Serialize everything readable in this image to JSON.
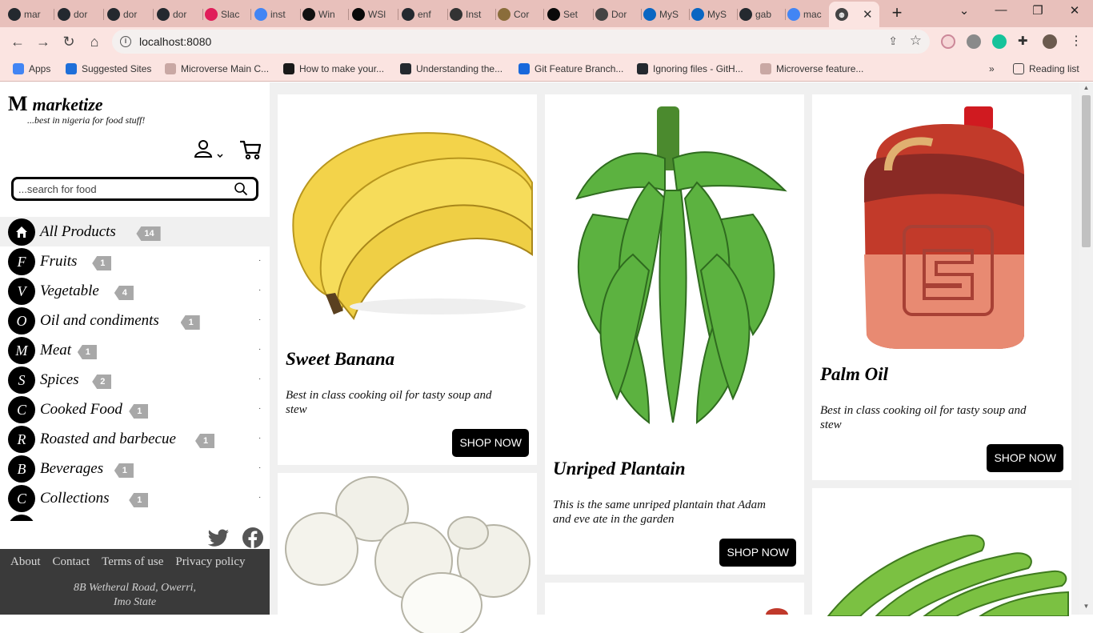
{
  "browser": {
    "tabs": [
      {
        "label": "mar",
        "color": "#24292f"
      },
      {
        "label": "dor",
        "color": "#24292f"
      },
      {
        "label": "dor",
        "color": "#24292f"
      },
      {
        "label": "dor",
        "color": "#24292f"
      },
      {
        "label": "Slac",
        "color": "#e01e5a"
      },
      {
        "label": "inst",
        "color": "#4285f4"
      },
      {
        "label": "Win",
        "color": "#111111"
      },
      {
        "label": "WSl",
        "color": "#0a0a0a"
      },
      {
        "label": "enf",
        "color": "#24292f"
      },
      {
        "label": "Inst",
        "color": "#333333"
      },
      {
        "label": "Cor",
        "color": "#8a6d3b"
      },
      {
        "label": "Set",
        "color": "#0a0a0a"
      },
      {
        "label": "Dor",
        "color": "#444444"
      },
      {
        "label": "MyS",
        "color": "#0a66c2"
      },
      {
        "label": "MyS",
        "color": "#0a66c2"
      },
      {
        "label": "gab",
        "color": "#24292f"
      },
      {
        "label": "mac",
        "color": "#4285f4"
      }
    ],
    "url": "localhost:8080",
    "bookmarks": [
      {
        "label": "Apps",
        "color": "#4285f4"
      },
      {
        "label": "Suggested Sites",
        "color": "#1e6fd9"
      },
      {
        "label": "Microverse Main C...",
        "color": "#c9a8a4"
      },
      {
        "label": "How to make your...",
        "color": "#1a1a1a"
      },
      {
        "label": "Understanding the...",
        "color": "#24292f"
      },
      {
        "label": "Git Feature Branch...",
        "color": "#1868db"
      },
      {
        "label": "Ignoring files - GitH...",
        "color": "#24292f"
      },
      {
        "label": "Microverse feature...",
        "color": "#c9a8a4"
      }
    ],
    "reading_list": "Reading list",
    "more_bookmarks": "»"
  },
  "brand": {
    "logo_letter": "M",
    "name": "marketize",
    "tagline": "...best in nigeria for food stuff!"
  },
  "search": {
    "placeholder": "...search for food"
  },
  "categories": [
    {
      "letter": "",
      "icon": "home-icon",
      "name": "All Products",
      "count": "14",
      "active": true
    },
    {
      "letter": "F",
      "name": "Fruits",
      "count": "1"
    },
    {
      "letter": "V",
      "name": "Vegetable",
      "count": "4"
    },
    {
      "letter": "O",
      "name": "Oil and condiments",
      "count": "1"
    },
    {
      "letter": "M",
      "name": "Meat",
      "count": "1"
    },
    {
      "letter": "S",
      "name": "Spices",
      "count": "2"
    },
    {
      "letter": "C",
      "name": "Cooked Food",
      "count": "1"
    },
    {
      "letter": "R",
      "name": "Roasted and barbecue",
      "count": "1"
    },
    {
      "letter": "B",
      "name": "Beverages",
      "count": "1"
    },
    {
      "letter": "C",
      "name": "Collections",
      "count": "1"
    }
  ],
  "footer": {
    "links": [
      "About",
      "Contact",
      "Terms of use",
      "Privacy policy"
    ],
    "address_line1": "8B Wetheral Road, Owerri,",
    "address_line2": "Imo State"
  },
  "products": [
    {
      "title": "Sweet Banana",
      "description": "Best in class cooking oil for tasty soup and stew",
      "button": "SHOP NOW",
      "image": "banana"
    },
    {
      "title": "Unriped Plantain",
      "description": "This is the same unriped plantain that Adam and eve ate in the garden",
      "button": "SHOP NOW",
      "image": "plantain"
    },
    {
      "title": "Palm Oil",
      "description": "Best in class cooking oil for tasty soup and stew",
      "button": "SHOP NOW",
      "image": "palm-oil"
    }
  ]
}
